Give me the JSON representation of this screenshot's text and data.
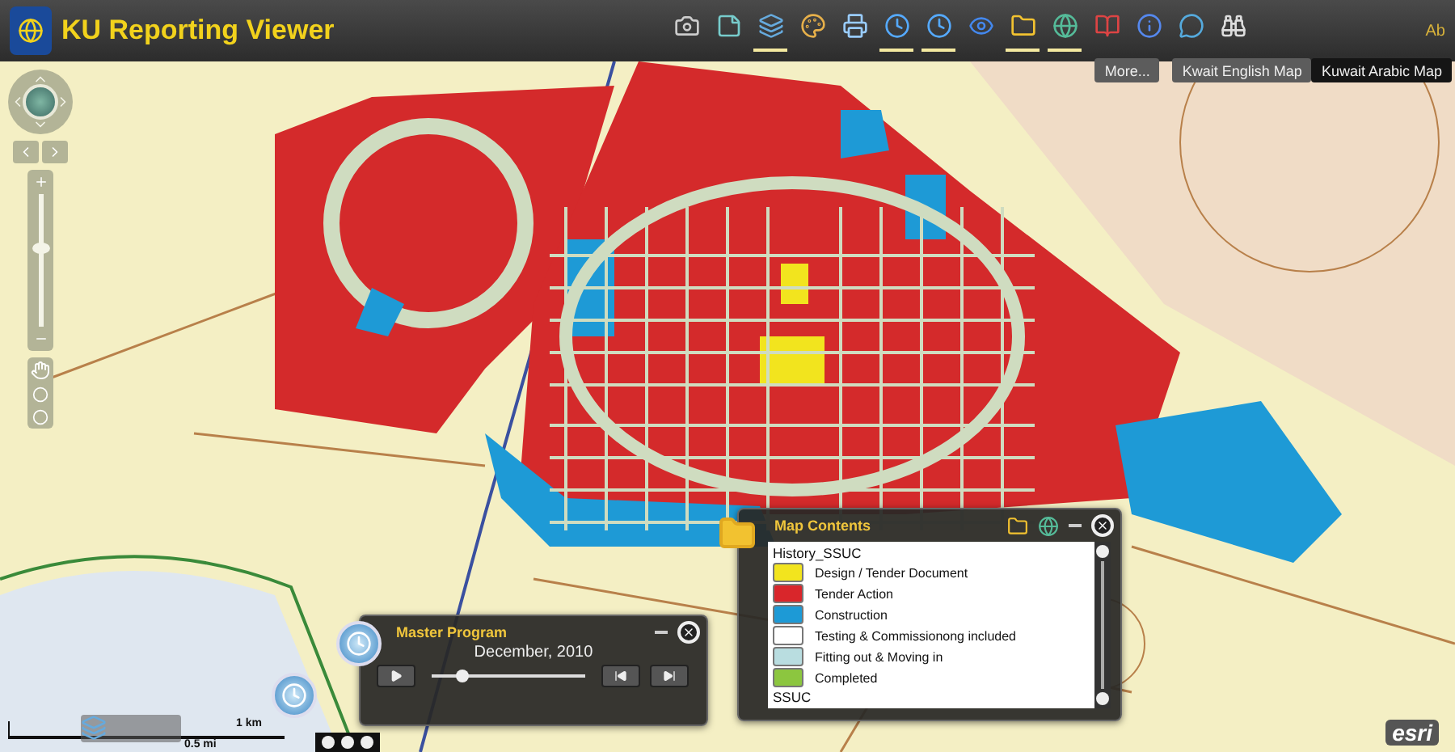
{
  "window": {
    "title": "KU Reporting Viewer",
    "user_label": "Ab"
  },
  "toolbar": [
    {
      "kind": "camera",
      "active": false
    },
    {
      "kind": "note",
      "active": false
    },
    {
      "kind": "layers",
      "active": true
    },
    {
      "kind": "palette",
      "active": false
    },
    {
      "kind": "printer",
      "active": false
    },
    {
      "kind": "clock",
      "active": true
    },
    {
      "kind": "clock",
      "active": true
    },
    {
      "kind": "eye",
      "active": false
    },
    {
      "kind": "folder",
      "active": true
    },
    {
      "kind": "globe",
      "active": true
    },
    {
      "kind": "book",
      "active": false
    },
    {
      "kind": "info",
      "active": false
    },
    {
      "kind": "chat",
      "active": false
    },
    {
      "kind": "binoculars",
      "active": false
    }
  ],
  "basemap": {
    "more": "More...",
    "options": [
      {
        "label": "Kwait English Map",
        "selected": false
      },
      {
        "label": "Kuwait Arabic Map",
        "selected": true
      }
    ]
  },
  "zoom": {
    "level": 0.55
  },
  "scale": {
    "km": "1 km",
    "mi": "0.5 mi"
  },
  "master_program": {
    "title": "Master Program",
    "date": "December, 2010",
    "level": 0.2
  },
  "map_contents": {
    "title": "Map Contents",
    "layer": "History_SSUC",
    "next_layer": "SSUC",
    "legend": [
      {
        "label": "Design / Tender Document",
        "color": "#f2e41e"
      },
      {
        "label": "Tender Action",
        "color": "#d9262b"
      },
      {
        "label": "Construction",
        "color": "#1d9ad6"
      },
      {
        "label": "Testing & Commissionong included",
        "color": "#ffffff"
      },
      {
        "label": "Fitting out & Moving in",
        "color": "#b9dde0"
      },
      {
        "label": "Completed",
        "color": "#8cc63f"
      }
    ]
  },
  "attribution": "esri"
}
